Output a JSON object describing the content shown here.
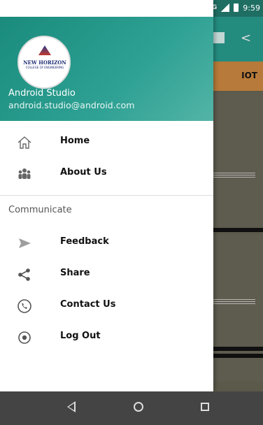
{
  "status": {
    "network": "4G",
    "time": "9:59"
  },
  "background": {
    "tab_label": "IOT"
  },
  "drawer": {
    "logo": {
      "title": "NEW HORIZON",
      "subtitle": "COLLEGE OF ENGINEERING"
    },
    "user": {
      "name": "Android Studio",
      "email": "android.studio@android.com"
    },
    "items": [
      {
        "label": "Home",
        "icon": "home-icon"
      },
      {
        "label": "About Us",
        "icon": "group-icon"
      }
    ],
    "section_title": "Communicate",
    "communicate_items": [
      {
        "label": "Feedback",
        "icon": "send-icon"
      },
      {
        "label": "Share",
        "icon": "share-icon"
      },
      {
        "label": "Contact Us",
        "icon": "phone-icon"
      },
      {
        "label": "Log Out",
        "icon": "radio-icon"
      }
    ]
  },
  "colors": {
    "header_start": "#1a8b7c",
    "header_end": "#53b4a6",
    "tab_bar": "#b77a3a"
  }
}
